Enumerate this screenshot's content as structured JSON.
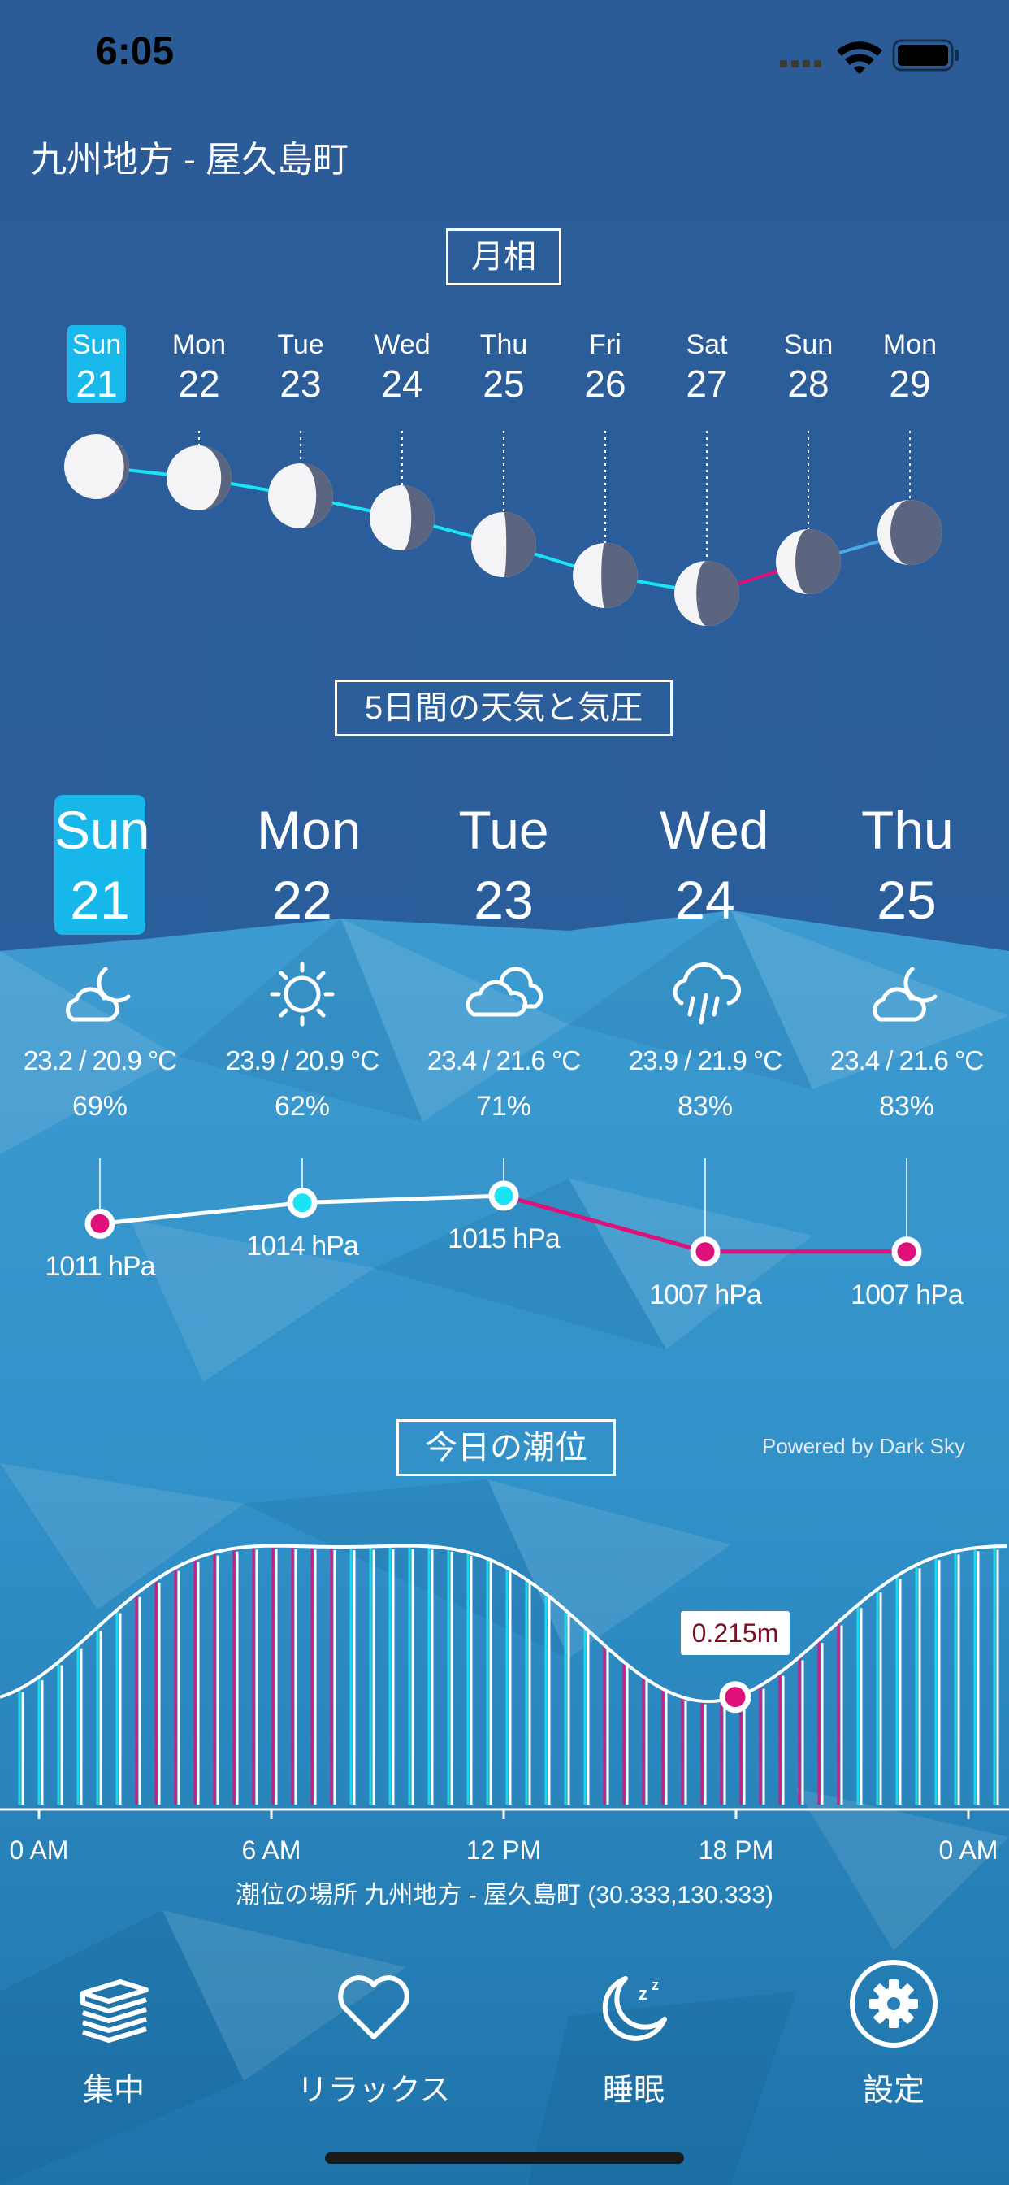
{
  "status": {
    "time": "6:05"
  },
  "location": "九州地方 - 屋久島町",
  "moon": {
    "title": "月相",
    "days": [
      {
        "name": "Sun",
        "num": "21",
        "selected": true
      },
      {
        "name": "Mon",
        "num": "22"
      },
      {
        "name": "Tue",
        "num": "23"
      },
      {
        "name": "Wed",
        "num": "24"
      },
      {
        "name": "Thu",
        "num": "25"
      },
      {
        "name": "Fri",
        "num": "26"
      },
      {
        "name": "Sat",
        "num": "27"
      },
      {
        "name": "Sun",
        "num": "28"
      },
      {
        "name": "Mon",
        "num": "29"
      }
    ]
  },
  "weather": {
    "title": "5日間の天気と気圧",
    "days": [
      {
        "name": "Sun",
        "num": "21",
        "selected": true,
        "icon": "partly-cloudy-night-icon",
        "temp": "23.2 / 20.9 °C",
        "humidity": "69%",
        "pressure": "1011 hPa"
      },
      {
        "name": "Mon",
        "num": "22",
        "icon": "sun-icon",
        "temp": "23.9 / 20.9 °C",
        "humidity": "62%",
        "pressure": "1014 hPa"
      },
      {
        "name": "Tue",
        "num": "23",
        "icon": "cloud-icon",
        "temp": "23.4 / 21.6 °C",
        "humidity": "71%",
        "pressure": "1015 hPa"
      },
      {
        "name": "Wed",
        "num": "24",
        "icon": "rain-icon",
        "temp": "23.9 / 21.9 °C",
        "humidity": "83%",
        "pressure": "1007 hPa"
      },
      {
        "name": "Thu",
        "num": "25",
        "icon": "partly-cloudy-night-icon",
        "temp": "23.4 / 21.6 °C",
        "humidity": "83%",
        "pressure": "1007 hPa"
      }
    ],
    "powered_by": "Powered by Dark Sky"
  },
  "tide": {
    "title": "今日の潮位",
    "current_value": "0.215m",
    "axis_labels": [
      "0 AM",
      "6 AM",
      "12 PM",
      "18 PM",
      "0 AM"
    ],
    "location_text": "潮位の場所 九州地方 - 屋久島町 (30.333,130.333)"
  },
  "tabs": [
    {
      "label": "集中",
      "icon": "books-icon"
    },
    {
      "label": "リラックス",
      "icon": "heart-icon"
    },
    {
      "label": "睡眠",
      "icon": "moon-sleep-icon"
    },
    {
      "label": "設定",
      "icon": "gear-icon"
    }
  ],
  "colors": {
    "accent": "#17b7ea",
    "cyan": "#19e3f5",
    "magenta": "#e0107a",
    "background_top": "#2a5e99",
    "background_bottom": "#2a8ec4"
  }
}
